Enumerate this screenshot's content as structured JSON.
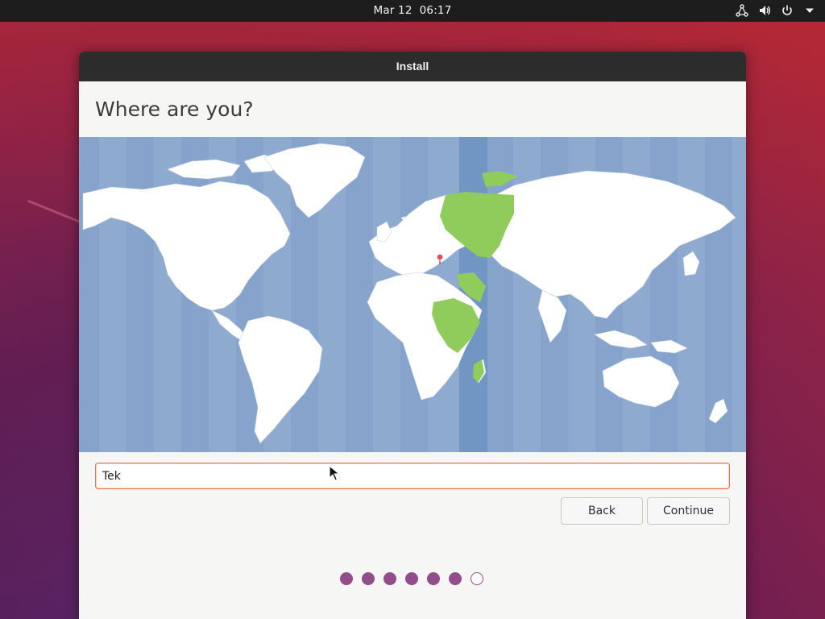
{
  "topbar": {
    "date": "Mar 12",
    "time": "06:17",
    "icons": [
      "network-icon",
      "volume-icon",
      "power-icon",
      "chevron-down-icon"
    ]
  },
  "window": {
    "title": "Install",
    "heading": "Where are you?"
  },
  "timezone": {
    "input_value": "Tek",
    "selected_band": "UTC+3",
    "marker_city": "Istanbul"
  },
  "buttons": {
    "back_label": "Back",
    "continue_label": "Continue"
  },
  "progress": {
    "total_steps": 7,
    "completed_steps": 6
  },
  "colors": {
    "accent": "#e95420",
    "dot": "#924d8b",
    "ocean": "#8eaacf",
    "highlight_band": "#7196c4",
    "highlight_land": "#8fcc5c",
    "land": "#ffffff"
  }
}
